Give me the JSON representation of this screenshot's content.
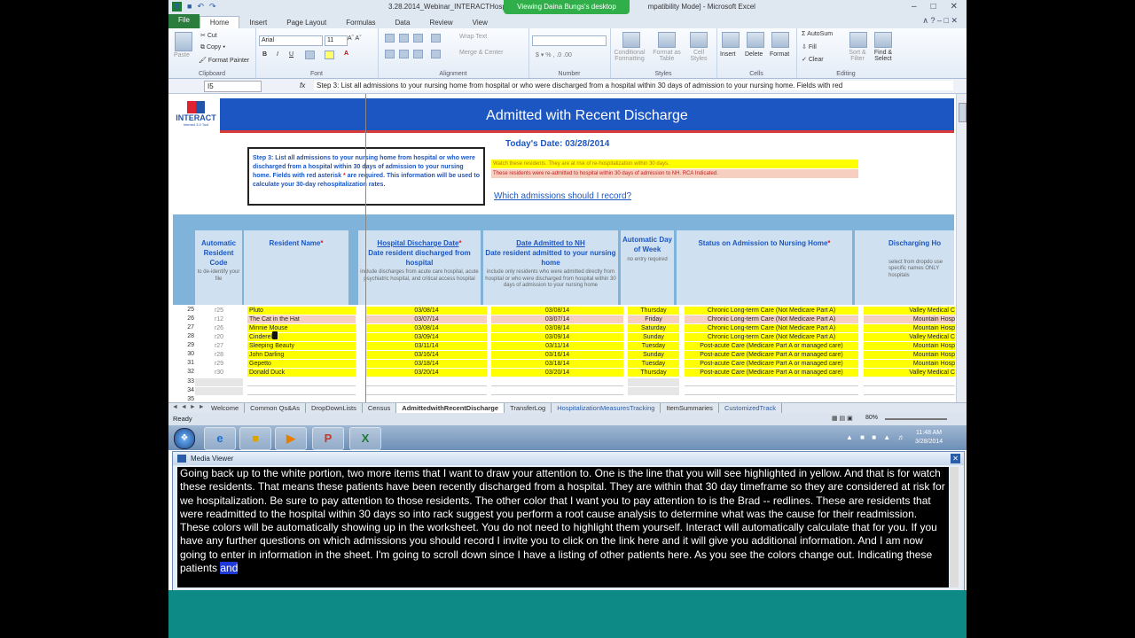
{
  "window": {
    "title": "3.28.2014_Webinar_INTERACTHospi",
    "title_suffix": "mpatibility Mode] - Microsoft Excel",
    "viewing_banner": "Viewing Daina Bungs's desktop"
  },
  "ribbon_tabs": [
    "File",
    "Home",
    "Insert",
    "Page Layout",
    "Formulas",
    "Data",
    "Review",
    "View"
  ],
  "ribbon": {
    "clipboard": {
      "paste": "Paste",
      "cut": "Cut",
      "copy": "Copy",
      "format_painter": "Format Painter",
      "label": "Clipboard"
    },
    "font": {
      "name": "Arial",
      "size": "11",
      "label": "Font"
    },
    "alignment": {
      "wrap": "Wrap Text",
      "merge": "Merge & Center",
      "label": "Alignment"
    },
    "number": {
      "label": "Number"
    },
    "styles": {
      "conditional": "Conditional Formatting",
      "table": "Format as Table",
      "cell": "Cell Styles",
      "label": "Styles"
    },
    "cells": {
      "insert": "Insert",
      "delete": "Delete",
      "format": "Format",
      "label": "Cells"
    },
    "editing": {
      "autosum": "AutoSum",
      "fill": "Fill",
      "clear": "Clear",
      "sort": "Sort & Filter",
      "find": "Find & Select",
      "label": "Editing"
    }
  },
  "formula_bar": {
    "name_box": "I5",
    "fx": "fx",
    "content": "Step 3:  List all admissions to your nursing home from hospital or who were discharged from a hospital within 30 days of admission to your nursing home. Fields with red"
  },
  "sheet": {
    "logo": "INTERACT",
    "logo_sub": "Interact 3.0 Tool",
    "title": "Admitted with Recent Discharge",
    "today": "Today's Date: 03/28/2014",
    "step_text_1": "Step 3:  List all admissions to your nursing home from hospital or who were discharged from a hospital within 30 days of admission to your nursing home. Fields with red asterisk",
    "step_asterisk": "*",
    "step_text_2": "are required. This information will be used to calculate your 30-day rehospitalization rates.",
    "legend_watch": "Watch these residents. They are at risk of re-hospitalization within 30 days.",
    "legend_readmit": "These residents were re-admitted to hospital within 30 days of admission to NH. RCA Indicated.",
    "link": "Which admissions should I record?",
    "headers": {
      "code": "Automatic Resident Code",
      "code_sub": "to de-identify your file",
      "name": "Resident Name",
      "hosp": "Hospital Discharge Date",
      "hosp2": "Date resident discharged from hospital",
      "hosp_sub": "include discharges from acute care hospital, acute psychiatric hospital, and critical access hospital",
      "adm": "Date Admitted to NH",
      "adm2": "Date resident admitted to your nursing home",
      "adm_sub": "include only residents who were admitted directly from hospital or who were discharged from hospital within 30 days of admission to your nursing home",
      "dow": "Automatic Day of Week",
      "dow_sub": "no entry required",
      "status": "Status on Admission to Nursing Home",
      "dh": "Discharging Ho",
      "dh_sub": "select from dropdo use specific names ONLY hospitals"
    },
    "rows": [
      {
        "n": "25",
        "code": "r25",
        "name": "Pluto",
        "hd": "03/08/14",
        "ad": "03/08/14",
        "dow": "Thursday",
        "status": "Chronic Long-term Care (Not Medicare Part A)",
        "dh": "Valley Medical C",
        "color": "#ffff00"
      },
      {
        "n": "26",
        "code": "r12",
        "name": "The Cat in the Hat",
        "hd": "03/07/14",
        "ad": "03/07/14",
        "dow": "Friday",
        "status": "Chronic Long-term Care (Not Medicare Part A)",
        "dh": "Mountain Hosp",
        "color": "#f7cfc0"
      },
      {
        "n": "27",
        "code": "r26",
        "name": "Minnie Mouse",
        "hd": "03/08/14",
        "ad": "03/08/14",
        "dow": "Saturday",
        "status": "Chronic Long-term Care (Not Medicare Part A)",
        "dh": "Mountain Hosp",
        "color": "#ffff00"
      },
      {
        "n": "28",
        "code": "r20",
        "name": "Cinderella",
        "hd": "03/09/14",
        "ad": "03/09/14",
        "dow": "Sunday",
        "status": "Chronic Long-term Care (Not Medicare Part A)",
        "dh": "Valley Medical C",
        "color": "#ffff00"
      },
      {
        "n": "29",
        "code": "r27",
        "name": "Sleeping Beauty",
        "hd": "03/11/14",
        "ad": "03/11/14",
        "dow": "Tuesday",
        "status": "Post-acute Care (Medicare Part A or managed care)",
        "dh": "Mountain Hosp",
        "color": "#ffff00"
      },
      {
        "n": "30",
        "code": "r28",
        "name": "John Darling",
        "hd": "03/16/14",
        "ad": "03/16/14",
        "dow": "Sunday",
        "status": "Post-acute Care (Medicare Part A or managed care)",
        "dh": "Mountain Hosp",
        "color": "#ffff00"
      },
      {
        "n": "31",
        "code": "r29",
        "name": "Gepetto",
        "hd": "03/18/14",
        "ad": "03/18/14",
        "dow": "Tuesday",
        "status": "Post-acute Care (Medicare Part A or managed care)",
        "dh": "Mountain Hosp",
        "color": "#ffff00"
      },
      {
        "n": "32",
        "code": "r30",
        "name": "Donald Duck",
        "hd": "03/20/14",
        "ad": "03/20/14",
        "dow": "Thursday",
        "status": "Post-acute Care (Medicare Part A or managed care)",
        "dh": "Valley Medical C",
        "color": "#ffff00"
      },
      {
        "n": "33",
        "code": "",
        "name": "",
        "hd": "",
        "ad": "",
        "dow": "",
        "status": "",
        "dh": "",
        "color": "#ffffff"
      },
      {
        "n": "34",
        "code": "",
        "name": "",
        "hd": "",
        "ad": "",
        "dow": "",
        "status": "",
        "dh": "",
        "color": "#ffffff"
      },
      {
        "n": "35",
        "code": "",
        "name": "",
        "hd": "",
        "ad": "",
        "dow": "",
        "status": "",
        "dh": "",
        "color": "#ffffff"
      }
    ]
  },
  "sheet_tabs": [
    "Welcome",
    "Common Qs&As",
    "DropDownLists",
    "Census",
    "AdmittedwithRecentDischarge",
    "TransferLog",
    "HospitalizationMeasuresTracking",
    "ItemSummaries",
    "CustomizedTrack"
  ],
  "active_sheet_index": 4,
  "status": {
    "ready": "Ready",
    "zoom": "80%"
  },
  "taskbar": {
    "time": "11:48 AM",
    "date": "3/28/2014"
  },
  "media_viewer": {
    "title": "Media Viewer",
    "caption": "Going back up to the white portion, two more items that I want to draw your attention to. One is the line that you will see highlighted in yellow. And that is for watch these residents. That means these patients have been recently discharged from a hospital. They are within that 30 day timeframe so they are considered at risk for we hospitalization. Be sure to pay attention to those residents. The other color that I want you to pay attention to is the Brad -- redlines. These are residents that were readmitted to the hospital within 30 days so into rack suggest you perform a root cause analysis to determine what was the cause for their readmission. These colors will be automatically showing up in the worksheet. You do not need to highlight them yourself. Interact will automatically calculate that for you. If you have any further questions on which admissions you should record I invite you to click on the link here and it will give you additional information. And I am now going to enter in information in the sheet. I'm going to scroll down since I have a listing of other patients here. As you see the colors change out. Indicating these patients",
    "caption_highlight": "and"
  }
}
